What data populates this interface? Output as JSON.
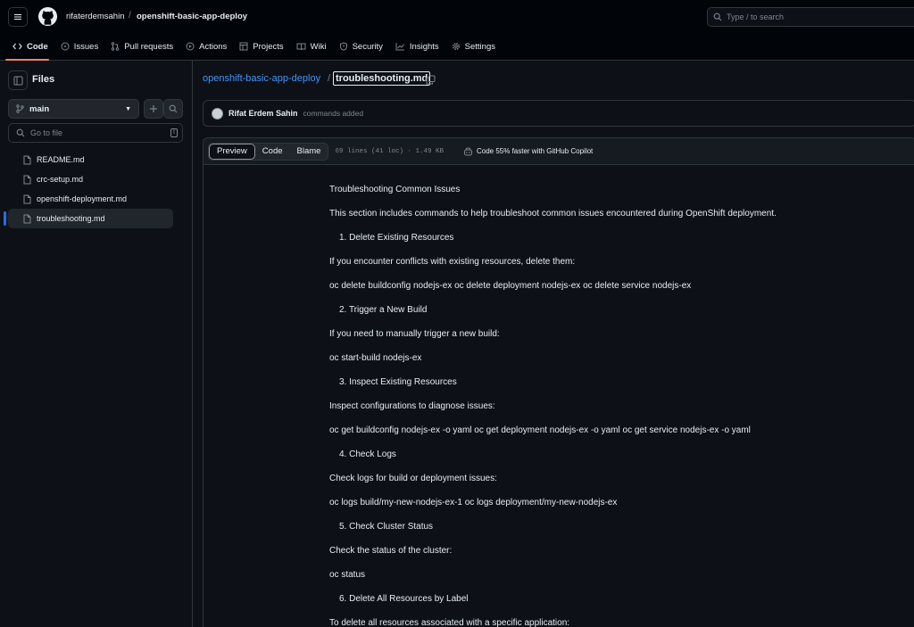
{
  "header": {
    "owner": "rifaterdemsahin",
    "separator": "/",
    "repo": "openshift-basic-app-deploy",
    "search_placeholder": "Type / to search"
  },
  "tabs": [
    {
      "label": "Code",
      "icon": "code-icon",
      "active": true
    },
    {
      "label": "Issues",
      "icon": "issue-icon"
    },
    {
      "label": "Pull requests",
      "icon": "pull-request-icon"
    },
    {
      "label": "Actions",
      "icon": "play-icon"
    },
    {
      "label": "Projects",
      "icon": "table-icon"
    },
    {
      "label": "Wiki",
      "icon": "book-icon"
    },
    {
      "label": "Security",
      "icon": "shield-icon"
    },
    {
      "label": "Insights",
      "icon": "graph-icon"
    },
    {
      "label": "Settings",
      "icon": "gear-icon"
    }
  ],
  "sidebar": {
    "title": "Files",
    "branch": "main",
    "goto_placeholder": "Go to file",
    "goto_shortcut": "t",
    "files": [
      {
        "name": "README.md",
        "selected": false
      },
      {
        "name": "crc-setup.md",
        "selected": false
      },
      {
        "name": "openshift-deployment.md",
        "selected": false
      },
      {
        "name": "troubleshooting.md",
        "selected": true
      }
    ]
  },
  "breadcrumb": {
    "repo": "openshift-basic-app-deploy",
    "separator": "/",
    "file": "troubleshooting.md"
  },
  "commit": {
    "author": "Rifat Erdem Sahin",
    "message": "commands added"
  },
  "file_header": {
    "preview": "Preview",
    "code": "Code",
    "blame": "Blame",
    "meta": "69 lines (41 loc) · 1.49 KB",
    "copilot": "Code 55% faster with GitHub Copilot"
  },
  "content": {
    "lines": [
      "Troubleshooting Common Issues",
      "This section includes commands to help troubleshoot common issues encountered during OpenShift deployment.",
      "1. Delete Existing Resources",
      "If you encounter conflicts with existing resources, delete them:",
      "oc delete buildconfig nodejs-ex oc delete deployment nodejs-ex oc delete service nodejs-ex",
      "2. Trigger a New Build",
      "If you need to manually trigger a new build:",
      "oc start-build nodejs-ex",
      "3. Inspect Existing Resources",
      "Inspect configurations to diagnose issues:",
      "oc get buildconfig nodejs-ex -o yaml oc get deployment nodejs-ex -o yaml oc get service nodejs-ex -o yaml",
      "4. Check Logs",
      "Check logs for build or deployment issues:",
      "oc logs build/my-new-nodejs-ex-1 oc logs deployment/my-new-nodejs-ex",
      "5. Check Cluster Status",
      "Check the status of the cluster:",
      "oc status",
      "6. Delete All Resources by Label",
      "To delete all resources associated with a specific application:"
    ]
  }
}
